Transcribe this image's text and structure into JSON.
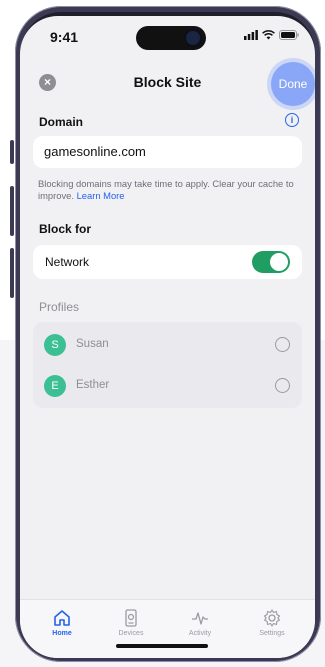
{
  "status": {
    "time": "9:41"
  },
  "header": {
    "title": "Block Site",
    "done_label": "Done"
  },
  "domain": {
    "label": "Domain",
    "value": "gamesonline.com"
  },
  "hint": {
    "text": "Blocking domains may take time to apply. Clear your cache to improve.",
    "link": "Learn More"
  },
  "block_for": {
    "label": "Block for",
    "network_label": "Network",
    "network_enabled": true
  },
  "profiles": {
    "label": "Profiles",
    "items": [
      {
        "initial": "S",
        "name": "Susan",
        "selected": false
      },
      {
        "initial": "E",
        "name": "Esther",
        "selected": false
      }
    ]
  },
  "tabs": [
    {
      "label": "Home",
      "icon": "home-icon",
      "active": true
    },
    {
      "label": "Devices",
      "icon": "devices-icon",
      "active": false
    },
    {
      "label": "Activity",
      "icon": "activity-icon",
      "active": false
    },
    {
      "label": "Settings",
      "icon": "gear-icon",
      "active": false
    }
  ],
  "colors": {
    "accent": "#2563eb",
    "toggle_on": "#1f9d63",
    "avatar": "#3cbf93",
    "done": "#8aa6f6"
  }
}
